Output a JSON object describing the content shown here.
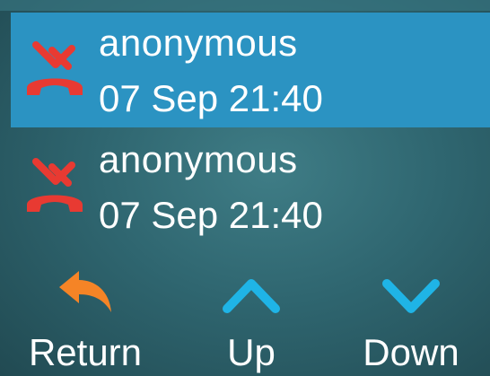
{
  "calls": [
    {
      "name": "anonymous",
      "time": "07 Sep 21:40",
      "icon": "missed-call-icon",
      "selected": true
    },
    {
      "name": "anonymous",
      "time": "07 Sep 21:40",
      "icon": "missed-call-icon",
      "selected": false
    }
  ],
  "softkeys": {
    "return_label": "Return",
    "up_label": "Up",
    "down_label": "Down"
  },
  "colors": {
    "selection": "#2b93c2",
    "missed_icon": "#e83a32",
    "return_icon": "#f58426",
    "nav_icon": "#1fb4e6",
    "text": "#ffffff"
  }
}
